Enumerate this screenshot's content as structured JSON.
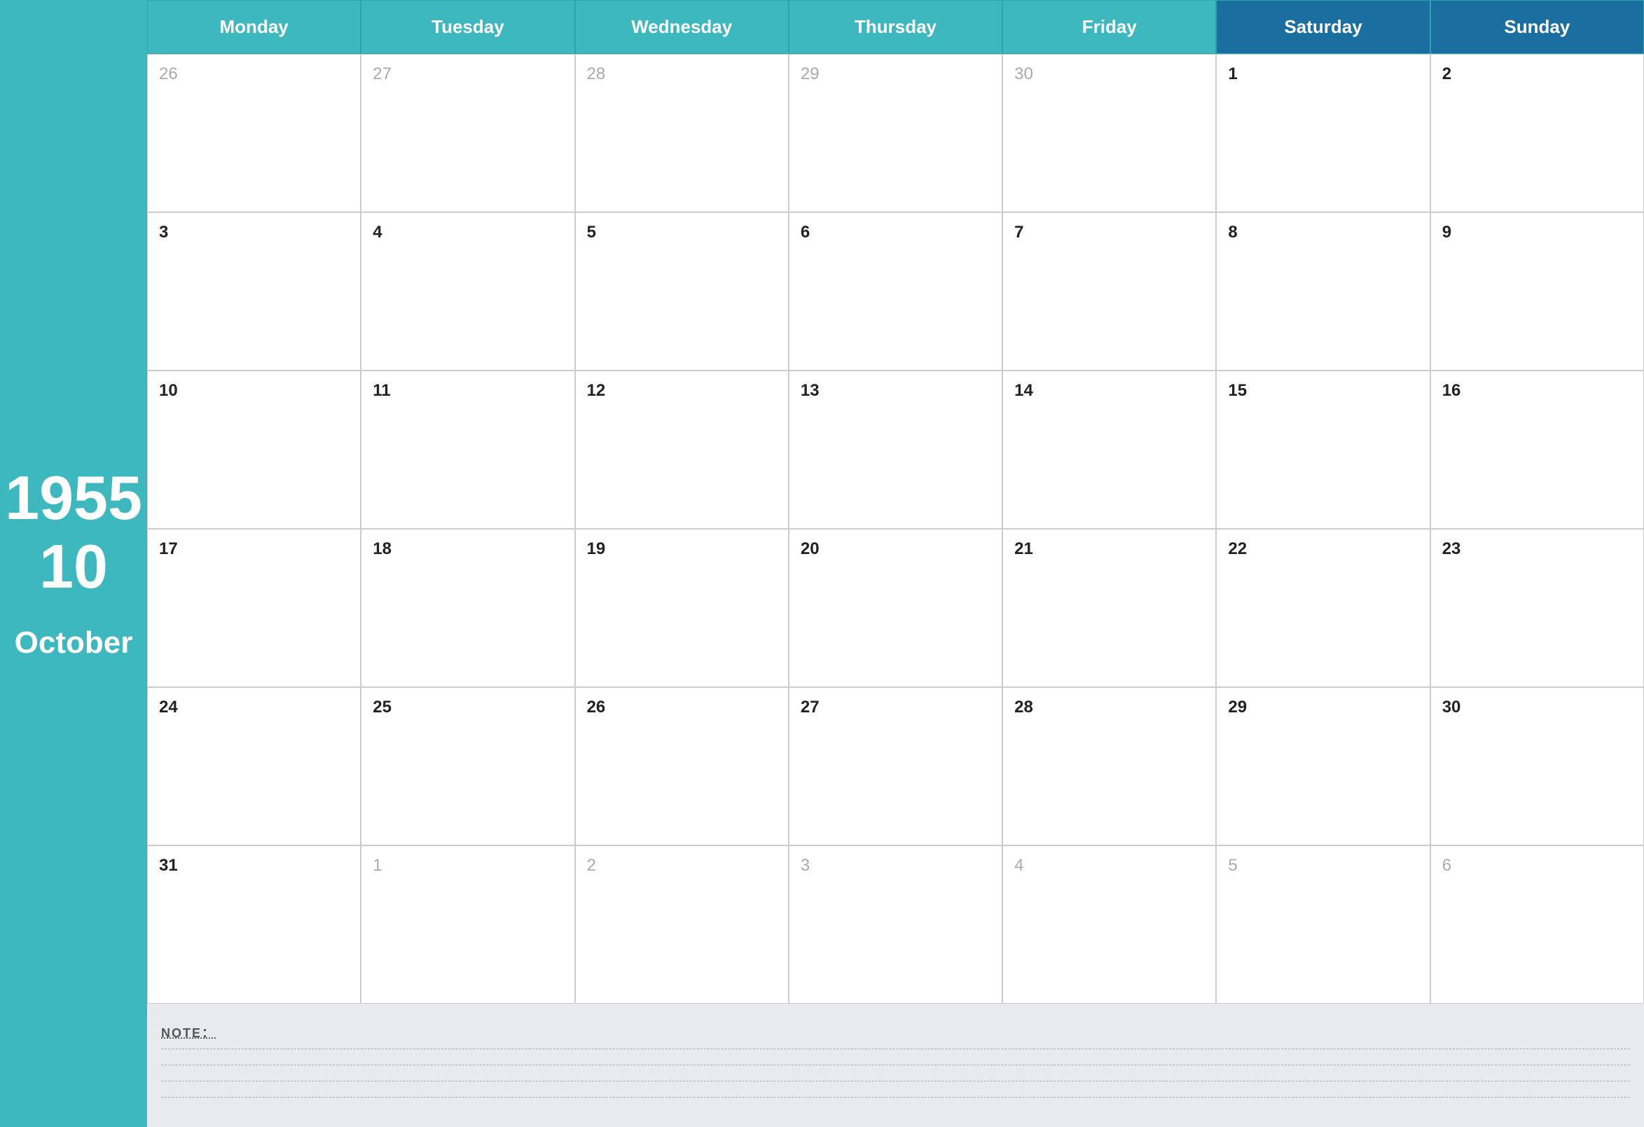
{
  "sidebar": {
    "year": "1955",
    "month_num": "10",
    "month_name": "October"
  },
  "header": {
    "days": [
      {
        "label": "Monday",
        "type": "weekday"
      },
      {
        "label": "Tuesday",
        "type": "weekday"
      },
      {
        "label": "Wednesday",
        "type": "weekday"
      },
      {
        "label": "Thursday",
        "type": "weekday"
      },
      {
        "label": "Friday",
        "type": "weekday"
      },
      {
        "label": "Saturday",
        "type": "weekend"
      },
      {
        "label": "Sunday",
        "type": "weekend"
      }
    ]
  },
  "weeks": [
    [
      {
        "num": "26",
        "other": true
      },
      {
        "num": "27",
        "other": true
      },
      {
        "num": "28",
        "other": true
      },
      {
        "num": "29",
        "other": true
      },
      {
        "num": "30",
        "other": true
      },
      {
        "num": "1",
        "other": false
      },
      {
        "num": "2",
        "other": false
      }
    ],
    [
      {
        "num": "3",
        "other": false
      },
      {
        "num": "4",
        "other": false
      },
      {
        "num": "5",
        "other": false
      },
      {
        "num": "6",
        "other": false
      },
      {
        "num": "7",
        "other": false
      },
      {
        "num": "8",
        "other": false
      },
      {
        "num": "9",
        "other": false
      }
    ],
    [
      {
        "num": "10",
        "other": false
      },
      {
        "num": "11",
        "other": false
      },
      {
        "num": "12",
        "other": false
      },
      {
        "num": "13",
        "other": false
      },
      {
        "num": "14",
        "other": false
      },
      {
        "num": "15",
        "other": false
      },
      {
        "num": "16",
        "other": false
      }
    ],
    [
      {
        "num": "17",
        "other": false
      },
      {
        "num": "18",
        "other": false
      },
      {
        "num": "19",
        "other": false
      },
      {
        "num": "20",
        "other": false
      },
      {
        "num": "21",
        "other": false
      },
      {
        "num": "22",
        "other": false
      },
      {
        "num": "23",
        "other": false
      }
    ],
    [
      {
        "num": "24",
        "other": false
      },
      {
        "num": "25",
        "other": false
      },
      {
        "num": "26",
        "other": false
      },
      {
        "num": "27",
        "other": false
      },
      {
        "num": "28",
        "other": false
      },
      {
        "num": "29",
        "other": false
      },
      {
        "num": "30",
        "other": false
      }
    ],
    [
      {
        "num": "31",
        "other": false
      },
      {
        "num": "1",
        "other": true
      },
      {
        "num": "2",
        "other": true
      },
      {
        "num": "3",
        "other": true
      },
      {
        "num": "4",
        "other": true
      },
      {
        "num": "5",
        "other": true
      },
      {
        "num": "6",
        "other": true
      }
    ]
  ],
  "notes": {
    "label": "NOTE：",
    "line_count": 4
  }
}
